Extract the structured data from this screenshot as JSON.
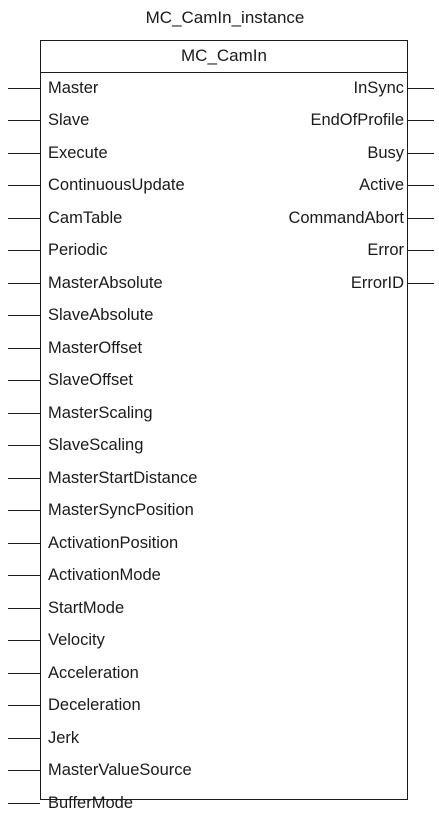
{
  "instance_name": "MC_CamIn_instance",
  "fb_name": "MC_CamIn",
  "inputs": [
    "Master",
    "Slave",
    "Execute",
    "ContinuousUpdate",
    "CamTable",
    "Periodic",
    "MasterAbsolute",
    "SlaveAbsolute",
    "MasterOffset",
    "SlaveOffset",
    "MasterScaling",
    "SlaveScaling",
    "MasterStartDistance",
    "MasterSyncPosition",
    "ActivationPosition",
    "ActivationMode",
    "StartMode",
    "Velocity",
    "Acceleration",
    "Deceleration",
    "Jerk",
    "MasterValueSource",
    "BufferMode"
  ],
  "outputs": [
    "InSync",
    "EndOfProfile",
    "Busy",
    "Active",
    "CommandAbort",
    "Error",
    "ErrorID"
  ]
}
